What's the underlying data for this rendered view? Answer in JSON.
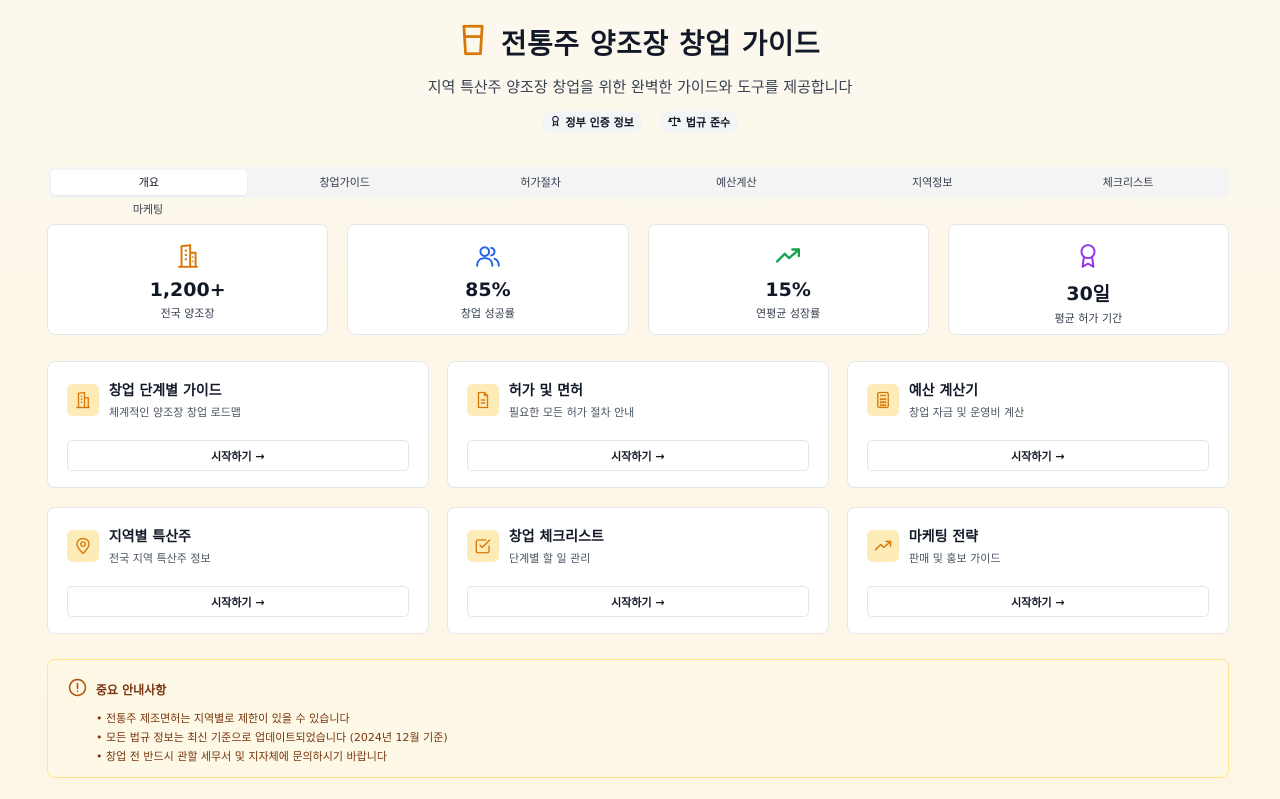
{
  "header": {
    "title": "전통주 양조장 창업 가이드",
    "subtitle": "지역 특산주 양조장 창업을 위한 완벽한 가이드와 도구를 제공합니다",
    "logo_icon": "beer-glass-icon",
    "badges": [
      {
        "label": "정부 인증 정보",
        "icon": "award-icon"
      },
      {
        "label": "법규 준수",
        "icon": "scale-icon"
      }
    ]
  },
  "tabs": {
    "items": [
      "개요",
      "창업가이드",
      "허가절차",
      "예산계산",
      "지역정보",
      "체크리스트"
    ],
    "overflow": "마케팅",
    "active": "개요"
  },
  "stats": [
    {
      "value": "1,200+",
      "label": "전국 양조장",
      "icon": "building-icon",
      "color": "#d97706"
    },
    {
      "value": "85%",
      "label": "창업 성공률",
      "icon": "users-icon",
      "color": "#2563eb"
    },
    {
      "value": "15%",
      "label": "연평균 성장률",
      "icon": "trending-up-icon",
      "color": "#16a34a"
    },
    {
      "value": "30일",
      "label": "평균 허가 기간",
      "icon": "award-icon",
      "color": "#9333ea"
    }
  ],
  "cards": [
    {
      "title": "창업 단계별 가이드",
      "desc": "체계적인 양조장 창업 로드맵",
      "button": "시작하기 →",
      "icon": "building-icon"
    },
    {
      "title": "허가 및 면허",
      "desc": "필요한 모든 허가 절차 안내",
      "button": "시작하기 →",
      "icon": "document-icon"
    },
    {
      "title": "예산 계산기",
      "desc": "창업 자금 및 운영비 계산",
      "button": "시작하기 →",
      "icon": "calculator-icon"
    },
    {
      "title": "지역별 특산주",
      "desc": "전국 지역 특산주 정보",
      "button": "시작하기 →",
      "icon": "map-pin-icon"
    },
    {
      "title": "창업 체크리스트",
      "desc": "단계별 할 일 관리",
      "button": "시작하기 →",
      "icon": "check-square-icon"
    },
    {
      "title": "마케팅 전략",
      "desc": "판매 및 홍보 가이드",
      "button": "시작하기 →",
      "icon": "trending-up-icon"
    }
  ],
  "notice": {
    "title": "중요 안내사항",
    "icon": "alert-circle-icon",
    "items": [
      "• 전통주 제조면허는 지역별로 제한이 있을 수 있습니다",
      "• 모든 법규 정보는 최신 기준으로 업데이트되었습니다 (2024년 12월 기준)",
      "• 창업 전 반드시 관할 세무서 및 지자체에 문의하시기 바랍니다"
    ]
  },
  "colors": {
    "accent": "#d97706",
    "card_icon_bg": "#fdecb8",
    "notice_bg": "#fef9e6",
    "notice_text": "#78350f"
  }
}
